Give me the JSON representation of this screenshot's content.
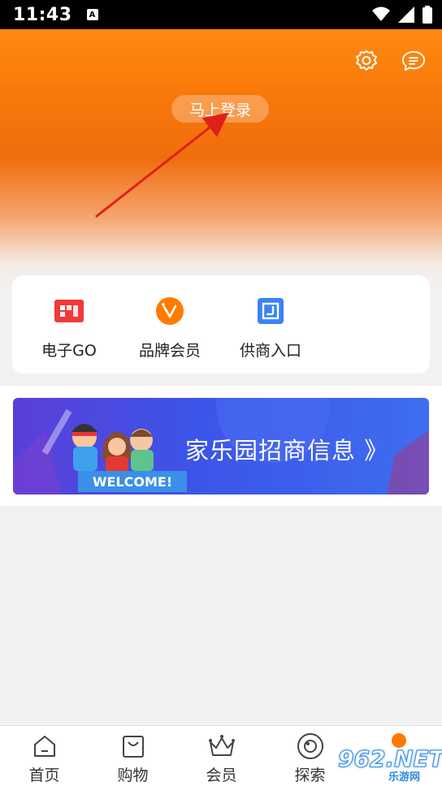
{
  "status_bar": {
    "time": "11:43",
    "notification_glyph": "A",
    "icons": [
      "wifi-icon",
      "signal-icon",
      "battery-icon"
    ]
  },
  "hero": {
    "login_label": "马上登录",
    "icons": [
      "settings-icon",
      "message-icon"
    ]
  },
  "quick_entries": [
    {
      "label": "电子GO",
      "icon": "qr-card-icon",
      "color": "#f0393b"
    },
    {
      "label": "品牌会员",
      "icon": "vip-v-icon",
      "color": "#ff7a00"
    },
    {
      "label": "供商入口",
      "icon": "supplier-entry-icon",
      "color": "#3b82f6"
    }
  ],
  "banner": {
    "text": "家乐园招商信息 》",
    "welcome": "WELCOME!"
  },
  "bottom_nav": [
    {
      "label": "首页",
      "icon": "home-icon"
    },
    {
      "label": "购物",
      "icon": "shopping-bag-icon"
    },
    {
      "label": "会员",
      "icon": "crown-icon"
    },
    {
      "label": "探索",
      "icon": "compass-icon"
    }
  ],
  "watermark": {
    "text": "962.NET",
    "subtext": "乐游网"
  },
  "colors": {
    "accent": "#f97a0a",
    "banner_blue": "#3b55e8",
    "arrow_red": "#e0201a"
  }
}
